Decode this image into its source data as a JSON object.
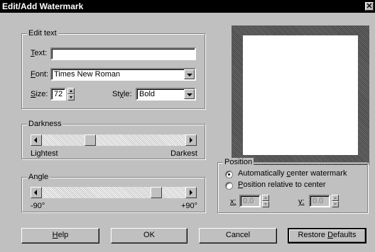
{
  "window": {
    "title": "Edit/Add Watermark",
    "close_glyph": "✕"
  },
  "edit_text": {
    "group_label": "Edit text",
    "text_label": "Text:",
    "text_accel": "T",
    "text_value": "",
    "font_label": "Font:",
    "font_accel": "F",
    "font_value": "Times New Roman",
    "size_label": "Size:",
    "size_accel": "S",
    "size_value": "72",
    "style_label": "Style:",
    "style_accel": "y",
    "style_value": "Bold"
  },
  "darkness": {
    "group_label": "Darkness",
    "min_label": "Lightest",
    "max_label": "Darkest",
    "level": 0.32
  },
  "angle": {
    "group_label": "Angle",
    "min_label": "-90°",
    "max_label": "+90°",
    "level": 0.82
  },
  "position": {
    "group_label": "Position",
    "option_center": "Automatically center watermark",
    "option_center_accel": "c",
    "option_relative": "Position relative to center",
    "option_relative_accel": "P",
    "selected": "center",
    "x_label": "x:",
    "x_value": "0.0",
    "y_label": "y:",
    "y_value": "0.0"
  },
  "buttons": {
    "help": "Help",
    "ok": "OK",
    "cancel": "Cancel",
    "restore": "Restore Defaults"
  },
  "icons": {
    "close": "close-icon",
    "dropdown": "chevron-down-icon",
    "spin_up": "caret-up-icon",
    "spin_down": "caret-down-icon",
    "scroll_left": "arrow-left-icon",
    "scroll_right": "arrow-right-icon"
  }
}
